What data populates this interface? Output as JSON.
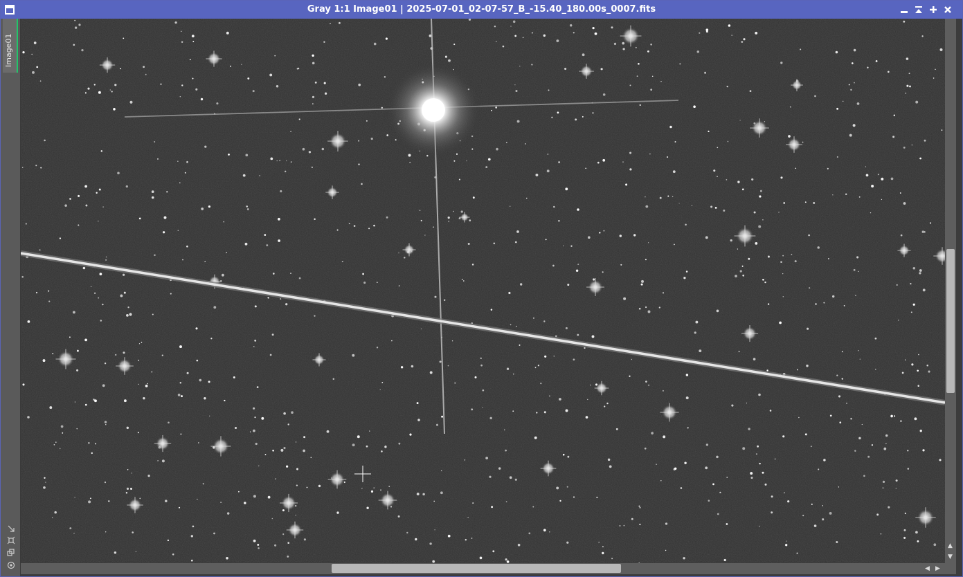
{
  "window": {
    "title": "Gray 1:1 Image01 | 2025-07-01_02-07-57_B_-15.40_180.00s_0007.fits",
    "icons": [
      "minimize-icon",
      "shade-icon",
      "maximize-icon",
      "close-icon"
    ]
  },
  "sidebar": {
    "tab_label": "Image01",
    "tools": [
      "fit-view-icon",
      "zoom-to-fit-icon",
      "clone-icon",
      "preview-icon"
    ]
  },
  "image": {
    "description_type": "astronomical-star-field",
    "background_color": "#303030",
    "accent": "#22c46a"
  },
  "colors": {
    "titlebar": "#5865c0",
    "scrollbar_track": "#5e5e5e",
    "scrollbar_thumb": "#b8b8b8"
  },
  "scroll": {
    "vertical_fraction": 0.42,
    "horizontal_fraction": 0.31
  }
}
